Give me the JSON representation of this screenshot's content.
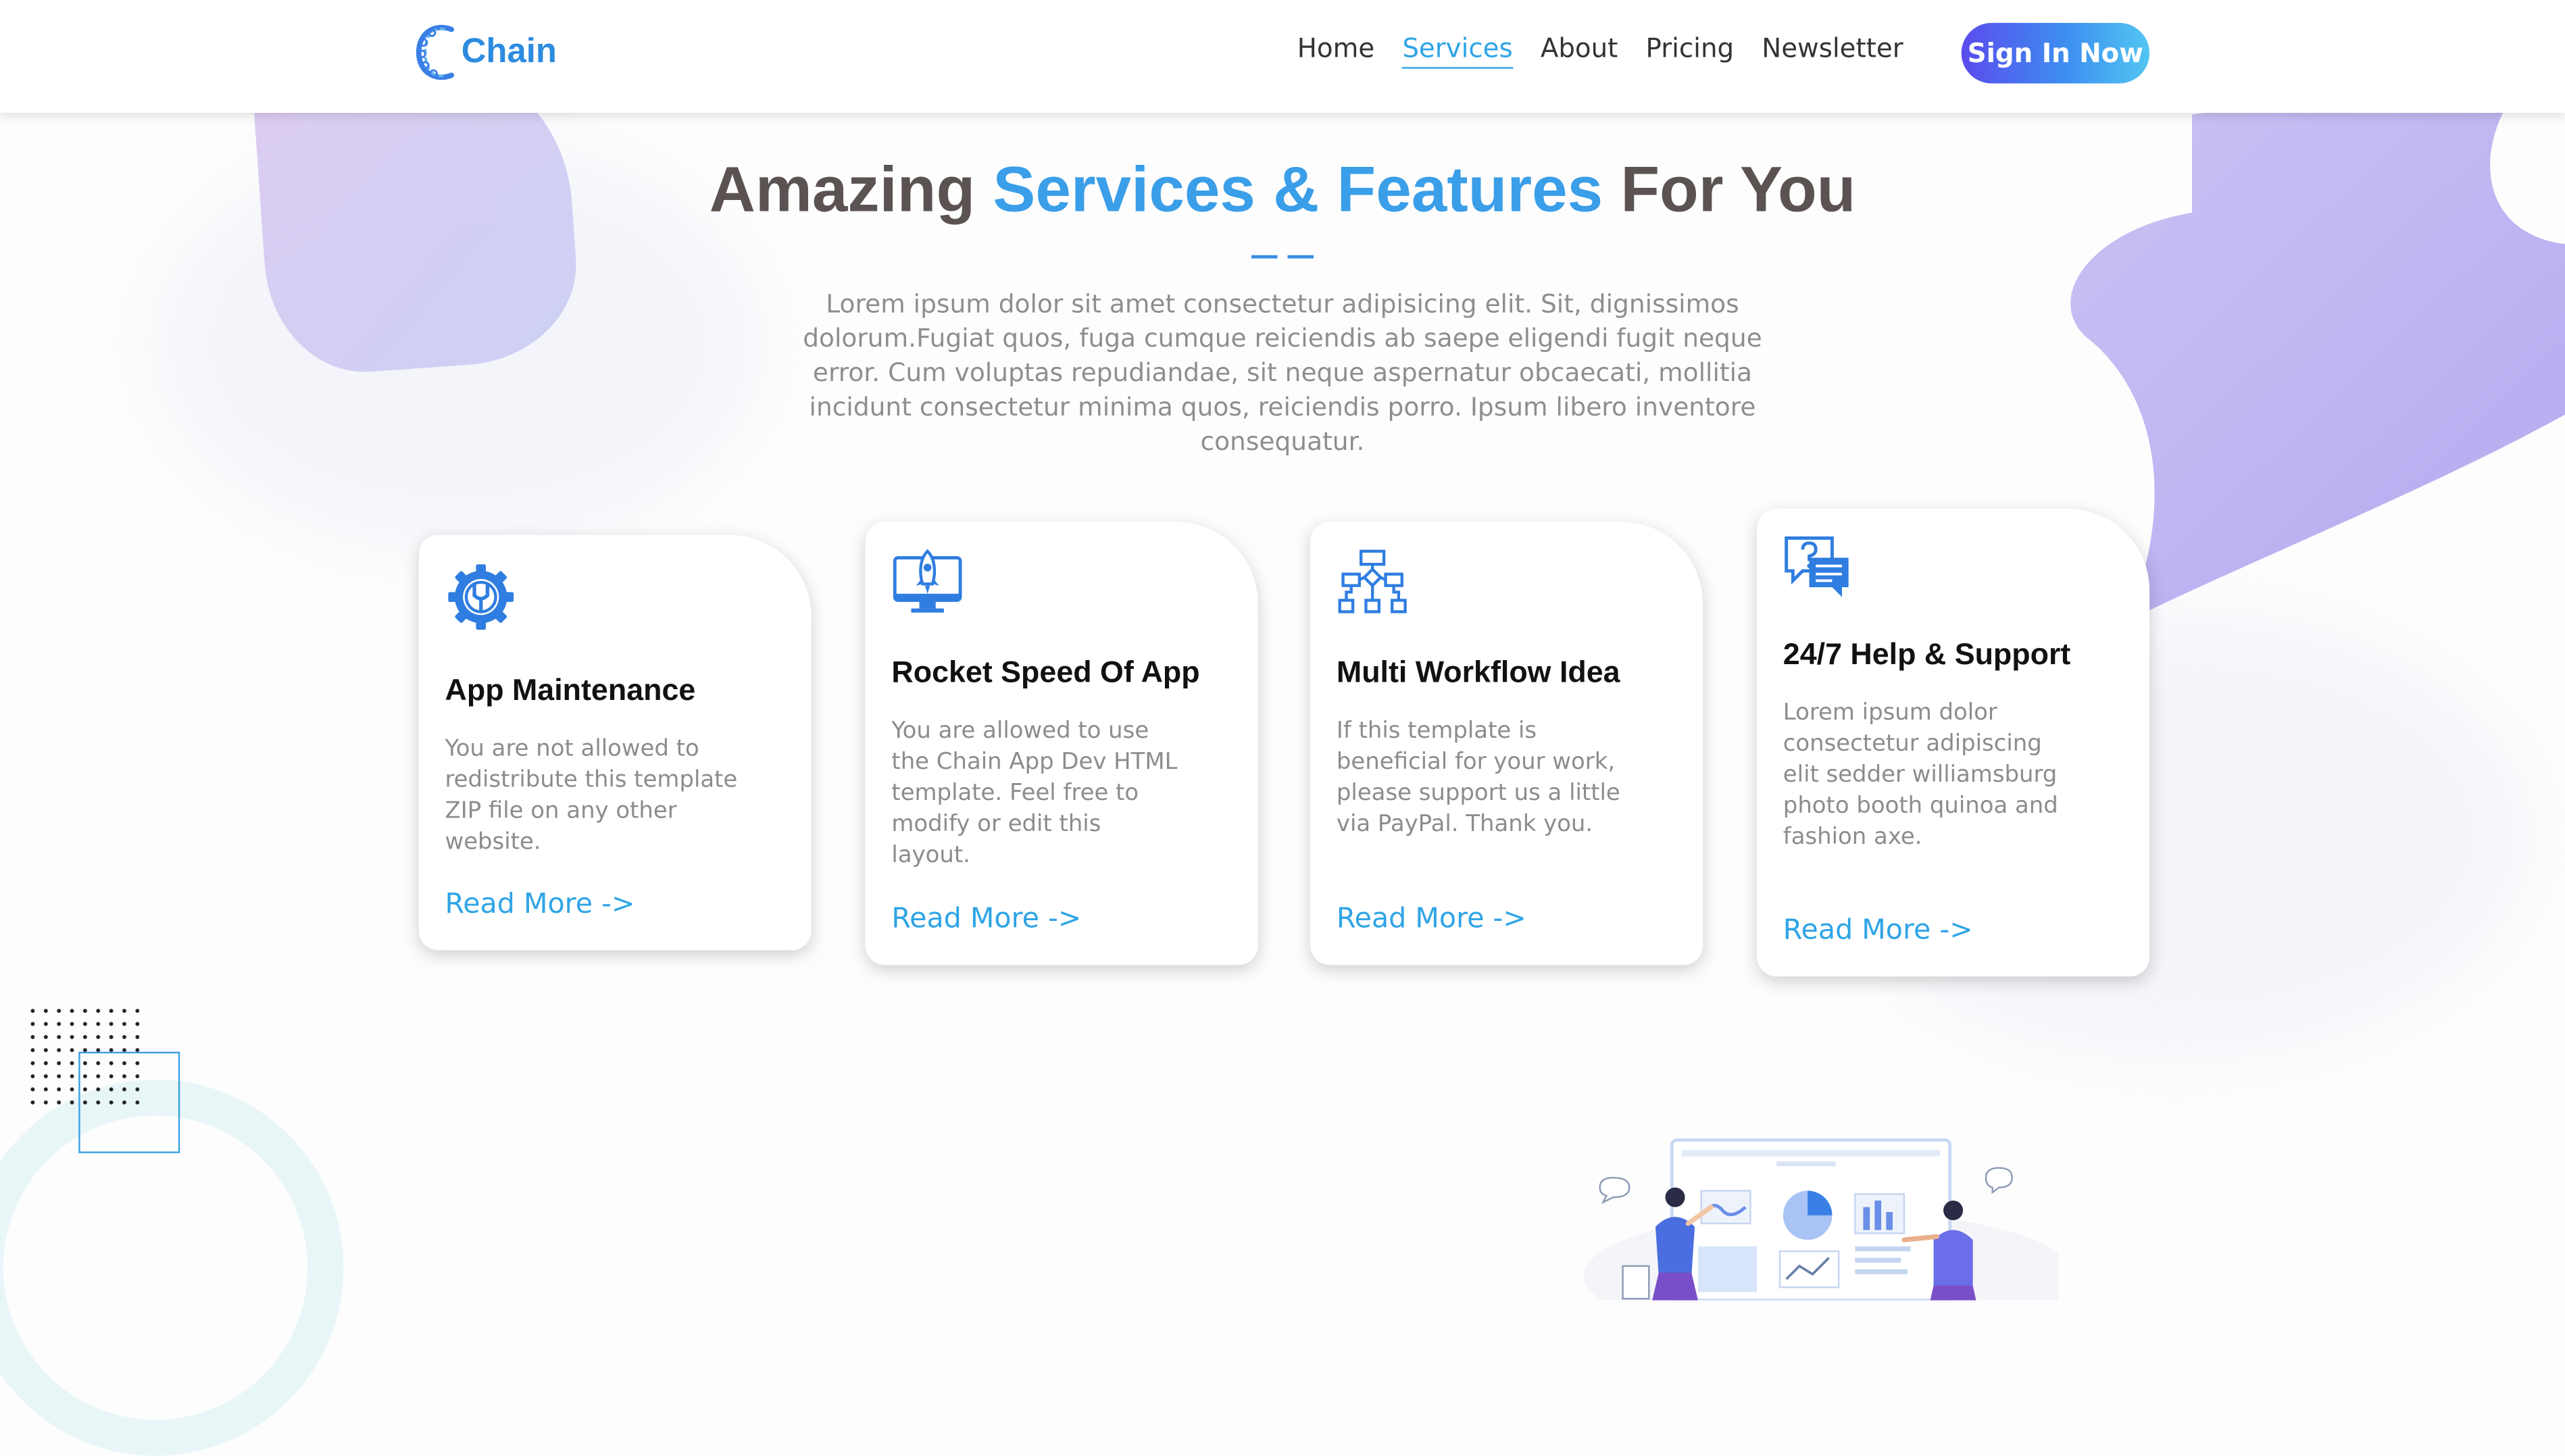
{
  "header": {
    "logo_text": "Chain",
    "nav": [
      {
        "label": "Home",
        "active": false
      },
      {
        "label": "Services",
        "active": true
      },
      {
        "label": "About",
        "active": false
      },
      {
        "label": "Pricing",
        "active": false
      },
      {
        "label": "Newsletter",
        "active": false
      }
    ],
    "signin_label": "Sign In Now"
  },
  "hero": {
    "title_part1": "Amazing",
    "title_highlight": "Services & Features",
    "title_part2": "For You",
    "description": "Lorem ipsum dolor sit amet consectetur adipisicing elit. Sit, dignissimos dolorum.Fugiat quos, fuga cumque reiciendis ab saepe eligendi fugit neque error. Cum voluptas repudiandae, sit neque aspernatur obcaecati, mollitia incidunt consectetur minima quos, reiciendis porro. Ipsum libero inventore consequatur."
  },
  "cards": [
    {
      "icon": "gear-wrench-icon",
      "title": "App Maintenance",
      "text": "You are not allowed to redistribute this template ZIP file on any other website.",
      "link": "Read More ->"
    },
    {
      "icon": "rocket-monitor-icon",
      "title": "Rocket Speed Of App",
      "text": "You are allowed to use the Chain App Dev HTML template. Feel free to modify or edit this layout.",
      "link": "Read More ->"
    },
    {
      "icon": "workflow-icon",
      "title": "Multi Workflow Idea",
      "text": "If this template is beneficial for your work, please support us a little via PayPal. Thank you.",
      "link": "Read More ->"
    },
    {
      "icon": "help-chat-icon",
      "title": "24/7 Help & Support",
      "text": "Lorem ipsum dolor consectetur adipiscing elit sedder williamsburg photo booth quinoa and fashion axe.",
      "link": "Read More ->"
    }
  ],
  "colors": {
    "accent": "#2ea4e6",
    "title": "#5a5352",
    "button_start": "#5a4bee",
    "button_end": "#52c6f2"
  }
}
